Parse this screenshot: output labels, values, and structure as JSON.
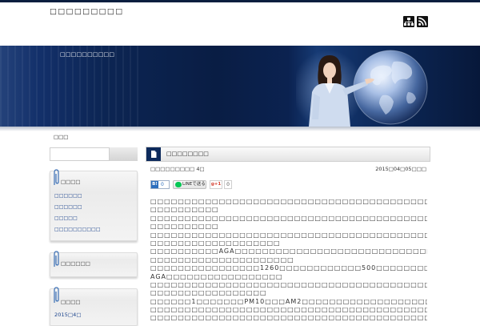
{
  "site": {
    "title": "□□□□□□□□□",
    "tagline": "□□□□□□□□□□"
  },
  "header_icons": [
    "sitemap-icon",
    "rss-icon"
  ],
  "breadcrumb": "□□□",
  "sidebar": {
    "widgets": [
      {
        "title": "□□□□",
        "items": [
          "□□□□□□",
          "□□□□□□",
          "□□□□□",
          "□□□□□□□□□□"
        ]
      },
      {
        "title": "□□□□□□"
      },
      {
        "title": "□□□□",
        "items": [
          "2015□4□"
        ]
      }
    ]
  },
  "post": {
    "title": "□□□□□□□□",
    "category": "□□□□□□□□□ 4□",
    "date": "2015□04□05□□□",
    "social": {
      "hatena_label": "B!",
      "hatena_count": "0",
      "line_label": "LINEで送る",
      "gplus_label": "g+1",
      "gplus_count": "0"
    },
    "lines": [
      "□□□□□□□□□□□□□□□□□□□□□□□□□□□□□□□□□□□□□□□□□□□□□□□□",
      "□□□□□□□□□□",
      "□□□□□□□□□□□□□□□□□□□□□□□□□□□□□□□□□□□□□□□□□□□□□□□□",
      "□□□□□□□□□□",
      "□□□□□□□□□□□□□□□□□□□□□□□□□□□□□□□□□□□□□□□□□□□□□□□□",
      "□□□□□□□□□□□□□□□□□□□",
      "□□□□□□□□□□AGA□□□□□□□□□□□□□□□□□□□□□□□□□□□□□□□□□□□",
      "□□□□□□□□□□□□□□□□□□□□□",
      "□□□□□□□□□□□□□□□□1260□□□□□□□□□□□□500□□□□□□□□□□□□□□□",
      "AGA□□□□□□□□□□□□□□□□□",
      "□□□□□□□□□□□□□□□□□□□□□□□□□□□□□□□□□□□□□□□□□□□□□□□□",
      "□□□□□□□□□□□□□□□□□",
      "□□□□□□1□□□□□□□PM10□□□AM2□□□□□□□□□□□□□□□□□□□□□□□",
      "□□□□□□□□□□□□□□□□□□□□□□□□□□□□□□□□□□□□□□□□□□□□□□□□",
      "□□□□□□□□□□□□□□□□□□□□□□□□□□□□□□□□□□□□□□□□□□□□□□□□"
    ]
  },
  "colors": {
    "brand_navy": "#0d2a5c",
    "link": "#163f8a",
    "line_green": "#06c755",
    "gplus_red": "#d44132",
    "hatena_blue": "#2c6ebd"
  }
}
